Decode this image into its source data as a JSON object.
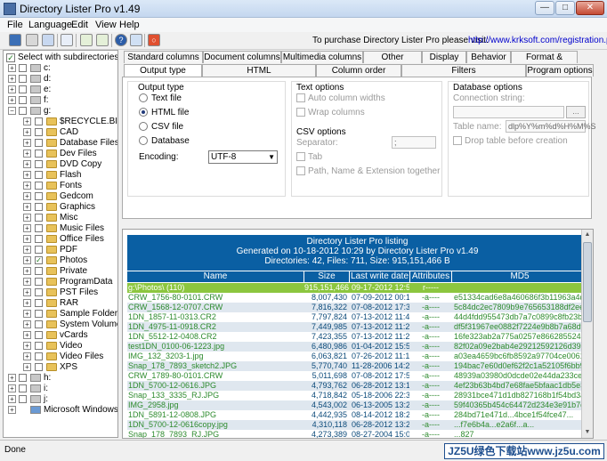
{
  "window": {
    "title": "Directory Lister Pro v1.49"
  },
  "menu": [
    "File",
    "Language",
    "Edit",
    "View",
    "Help"
  ],
  "toolbar": {
    "purchase_text": "To purchase Directory Lister Pro please visit:",
    "purchase_link": "http://www.krksoft.com/registration.php"
  },
  "tree": {
    "subdirs_label": "Select with subdirectories",
    "drives": [
      {
        "label": "c:"
      },
      {
        "label": "d:"
      },
      {
        "label": "e:"
      },
      {
        "label": "f:"
      },
      {
        "label": "g:"
      }
    ],
    "folders": [
      {
        "label": "$RECYCLE.BIN",
        "checked": false
      },
      {
        "label": "CAD",
        "checked": false
      },
      {
        "label": "Database Files",
        "checked": false
      },
      {
        "label": "Dev Files",
        "checked": false
      },
      {
        "label": "DVD Copy",
        "checked": false
      },
      {
        "label": "Flash",
        "checked": false
      },
      {
        "label": "Fonts",
        "checked": false
      },
      {
        "label": "Gedcom",
        "checked": false
      },
      {
        "label": "Graphics",
        "checked": false
      },
      {
        "label": "Misc",
        "checked": false
      },
      {
        "label": "Music Files",
        "checked": false
      },
      {
        "label": "Office Files",
        "checked": false
      },
      {
        "label": "PDF",
        "checked": false
      },
      {
        "label": "Photos",
        "checked": true
      },
      {
        "label": "Private",
        "checked": false
      },
      {
        "label": "ProgramData",
        "checked": false
      },
      {
        "label": "PST Files",
        "checked": false
      },
      {
        "label": "RAR",
        "checked": false
      },
      {
        "label": "Sample Folder",
        "checked": false
      },
      {
        "label": "System Volume Info",
        "checked": false
      },
      {
        "label": "vCards",
        "checked": false
      },
      {
        "label": "Video",
        "checked": false
      },
      {
        "label": "Video Files",
        "checked": false
      },
      {
        "label": "XPS",
        "checked": false
      }
    ],
    "bottom_drives": [
      {
        "label": "h:"
      },
      {
        "label": "i:"
      },
      {
        "label": "j:"
      }
    ],
    "network": "Microsoft Windows Network"
  },
  "tabs_row1": [
    "Standard columns",
    "Document columns",
    "Multimedia columns",
    "Other columns",
    "Display",
    "Behavior",
    "Format & sorting"
  ],
  "tabs_row2": [
    "Output type",
    "HTML",
    "Column order",
    "Filters",
    "Program options"
  ],
  "output_type": {
    "heading": "Output type",
    "options": [
      "Text file",
      "HTML file",
      "CSV file",
      "Database"
    ],
    "selected": "HTML file",
    "encoding_label": "Encoding:",
    "encoding_value": "UTF-8"
  },
  "text_options": {
    "heading": "Text options",
    "auto_width": "Auto column widths",
    "wrap": "Wrap columns"
  },
  "csv_options": {
    "heading": "CSV options",
    "separator_label": "Separator:",
    "separator_value": ";",
    "tab": "Tab",
    "path_together": "Path, Name & Extension together"
  },
  "db_options": {
    "heading": "Database options",
    "conn_label": "Connection string:",
    "browse": "...",
    "table_label": "Table name:",
    "table_value": "dlp%Y%m%d%H%M%S",
    "drop_label": "Drop table before creation"
  },
  "listing": {
    "title": "Directory Lister Pro listing",
    "generated": "Generated on 10-18-2012 10:29 by Directory Lister Pro v1.49",
    "summary": "Directories: 42, Files: 711, Size: 915,151,466 B",
    "columns": [
      "Name",
      "Size",
      "Last write date",
      "Attributes",
      "MD5"
    ],
    "rows": [
      {
        "name": "g:\\Photos\\ (110)",
        "size": "915,151,466",
        "date": "09-17-2012 12:51",
        "attr": "r-----",
        "md5": "",
        "folder": true
      },
      {
        "name": "CRW_1756-80-0101.CRW",
        "size": "8,007,430",
        "date": "07-09-2012 00:10",
        "attr": "-a----",
        "md5": "e51334cad6e8a460686f3b11963a4d1a"
      },
      {
        "name": "CRW_1568-12-0707.CRW",
        "size": "7,816,322",
        "date": "07-08-2012 17:30",
        "attr": "-a----",
        "md5": "5c84dc2ec7809b9e765653188df2ee0d"
      },
      {
        "name": "1DN_1857-11-0313.CR2",
        "size": "7,797,824",
        "date": "07-13-2012 11:48",
        "attr": "-a----",
        "md5": "44d4fdd955473db7a7c0899c8fb23bd6"
      },
      {
        "name": "1DN_4975-11-0918.CR2",
        "size": "7,449,985",
        "date": "07-13-2012 11:28",
        "attr": "-a----",
        "md5": "df5f31967ee0882f7224e9b8b7a68df"
      },
      {
        "name": "1DN_5512-12-0408.CR2",
        "size": "7,423,355",
        "date": "07-13-2012 11:22",
        "attr": "-a----",
        "md5": "16fe323ab2a775a0257e866285524754"
      },
      {
        "name": "test1DN_0100-06-1223.jpg",
        "size": "6,480,986",
        "date": "01-04-2012 15:52",
        "attr": "-a----",
        "md5": "82f02a09e2bab4e29212592126d398f3"
      },
      {
        "name": "IMG_132_3203-1.jpg",
        "size": "6,063,821",
        "date": "07-26-2012 11:15",
        "attr": "-a----",
        "md5": "a03ea4659bc6fb8592a97704ce00615e"
      },
      {
        "name": "Snap_178_7893_sketch2.JPG",
        "size": "5,770,740",
        "date": "11-28-2006 14:21",
        "attr": "-a----",
        "md5": "194bac7e60d0ef62f2c1a52105f6bb96"
      },
      {
        "name": "CRW_1789-80-0101.CRW",
        "size": "5,011,698",
        "date": "07-08-2012 17:56",
        "attr": "-a----",
        "md5": "48939a03980d0dcde02e44da233ce9cbd"
      },
      {
        "name": "1DN_5700-12-0616.JPG",
        "size": "4,793,762",
        "date": "06-28-2012 13:12",
        "attr": "-a----",
        "md5": "4ef23b63b4bd7e68fae5bfaac1db5e3f"
      },
      {
        "name": "Snap_133_3335_RJ.JPG",
        "size": "4,718,842",
        "date": "05-18-2006 22:38",
        "attr": "-a----",
        "md5": "28931bce471d1db827168b1f54bd3a5f"
      },
      {
        "name": "IMG_2958.jpg",
        "size": "4,543,002",
        "date": "06-13-2005 13:23",
        "attr": "-a----",
        "md5": "59f40365b454c64472d234e3e91b7d2e"
      },
      {
        "name": "1DN_5891-12-0808.JPG",
        "size": "4,442,935",
        "date": "08-14-2012 18:23",
        "attr": "-a----",
        "md5": "284bd71e471d...4bce1f54fce47..."
      },
      {
        "name": "1DN_5700-12-0616copy.jpg",
        "size": "4,310,118",
        "date": "06-28-2012 13:22",
        "attr": "-a----",
        "md5": "...f7e6b4a...e2a6f...a..."
      },
      {
        "name": "Snap_178_7893_RJ.JPG",
        "size": "4,273,389",
        "date": "08-27-2004 15:07",
        "attr": "-a----",
        "md5": "...827"
      }
    ]
  },
  "status": {
    "text": "Done"
  },
  "watermark": "JZ5U绿色下载站www.jz5u.com"
}
